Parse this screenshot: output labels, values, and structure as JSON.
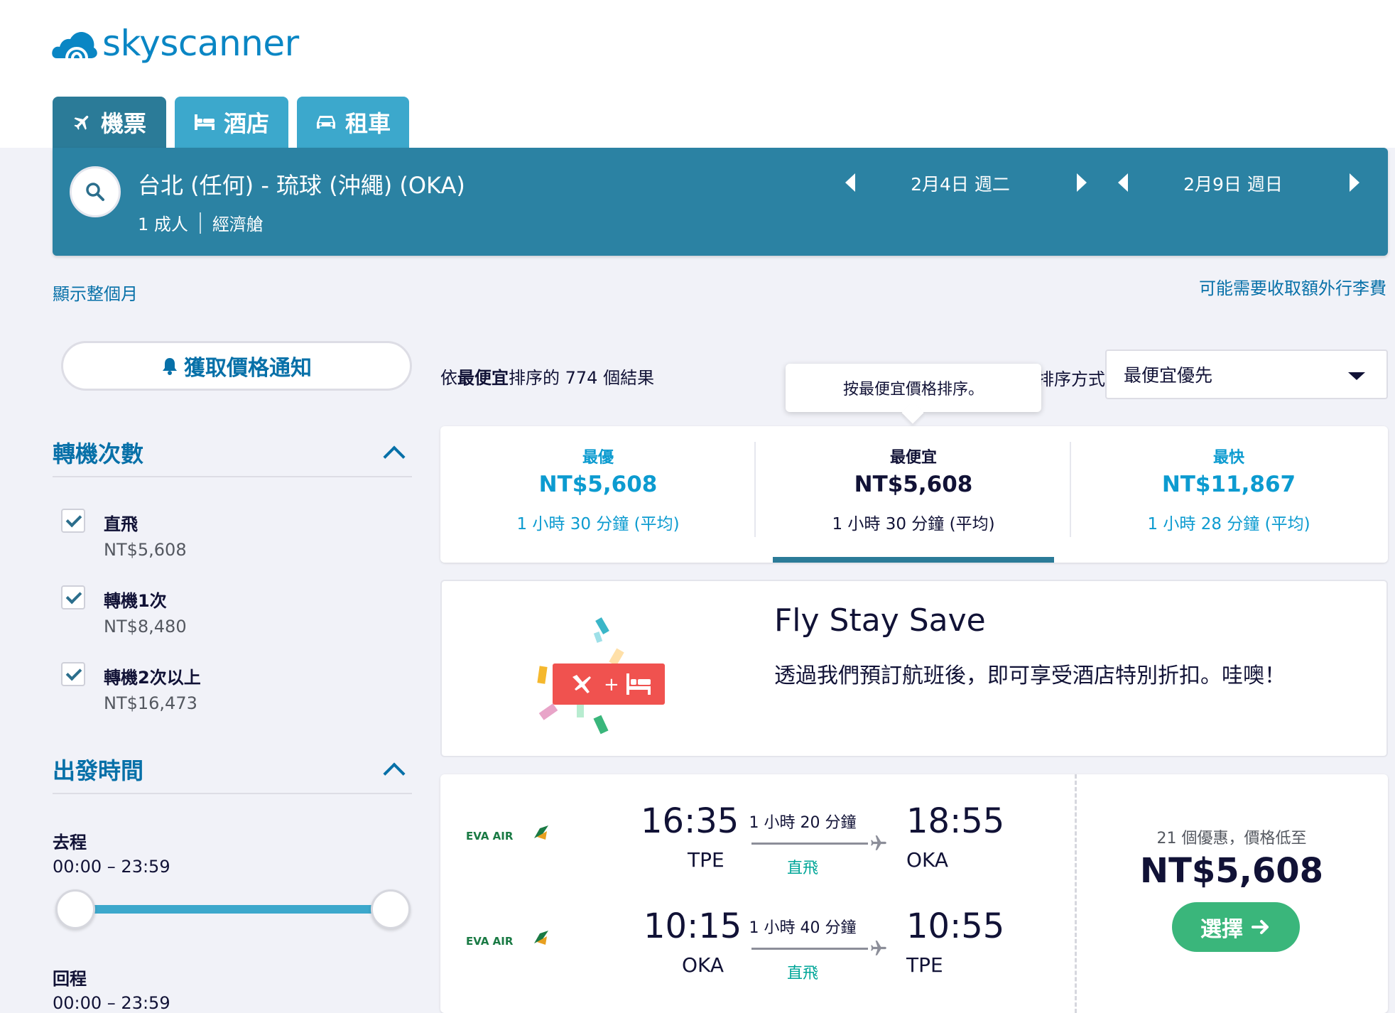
{
  "brand": {
    "name": "skyscanner",
    "color": "#0a86c4"
  },
  "tabs": [
    {
      "label": "機票",
      "icon": "plane-icon",
      "active": true
    },
    {
      "label": "酒店",
      "icon": "bed-icon",
      "active": false
    },
    {
      "label": "租車",
      "icon": "car-icon",
      "active": false
    }
  ],
  "search": {
    "route": "台北 (任何) - 琉球 (沖繩) (OKA)",
    "passengers": "1 成人",
    "cabin": "經濟艙",
    "depart_date": "2月4日 週二",
    "return_date": "2月9日 週日"
  },
  "links": {
    "show_month": "顯示整個月",
    "extra_bag_fees": "可能需要收取額外行李費"
  },
  "sidebar": {
    "price_alert": "獲取價格通知",
    "stops": {
      "title": "轉機次數",
      "options": [
        {
          "label": "直飛",
          "price": "NT$5,608",
          "checked": true
        },
        {
          "label": "轉機1次",
          "price": "NT$8,480",
          "checked": true
        },
        {
          "label": "轉機2次以上",
          "price": "NT$16,473",
          "checked": true
        }
      ]
    },
    "times": {
      "title": "出發時間",
      "outbound_label": "去程",
      "outbound_range": "00:00 – 23:59",
      "return_label": "回程",
      "return_range": "00:00 – 23:59"
    }
  },
  "results": {
    "count_prefix": "依",
    "count_bold": "最便宜",
    "count_suffix": "排序的 774 個結果",
    "tooltip": "按最便宜價格排序。",
    "sort_label": "排序方式",
    "sort_value": "最便宜優先"
  },
  "sort_tabs": [
    {
      "name": "最優",
      "price": "NT$5,608",
      "duration": "1 小時 30 分鐘 (平均)"
    },
    {
      "name": "最便宜",
      "price": "NT$5,608",
      "duration": "1 小時 30 分鐘 (平均)"
    },
    {
      "name": "最快",
      "price": "NT$11,867",
      "duration": "1 小時 28 分鐘 (平均)"
    }
  ],
  "promo": {
    "title": "Fly Stay Save",
    "description": "透過我們預訂航班後，即可享受酒店特別折扣。哇噢！"
  },
  "flight_card": {
    "airline": "EVA AIR",
    "legs": [
      {
        "dep_time": "16:35",
        "dep_code": "TPE",
        "duration": "1 小時 20 分鐘",
        "stops": "直飛",
        "arr_time": "18:55",
        "arr_code": "OKA"
      },
      {
        "dep_time": "10:15",
        "dep_code": "OKA",
        "duration": "1 小時 40 分鐘",
        "stops": "直飛",
        "arr_time": "10:55",
        "arr_code": "TPE"
      }
    ],
    "deals": "21 個優惠，價格低至",
    "price": "NT$5,608",
    "select_label": "選擇"
  },
  "colors": {
    "search_bar": "#2b82a3",
    "tab_active": "#2b7b98",
    "tab_inactive": "#3ca8cc",
    "link": "#0770a8",
    "highlight_blue": "#0c9bd0",
    "direct_green": "#00a698",
    "select_button": "#3ab67b",
    "promo_red": "#f0524f"
  }
}
